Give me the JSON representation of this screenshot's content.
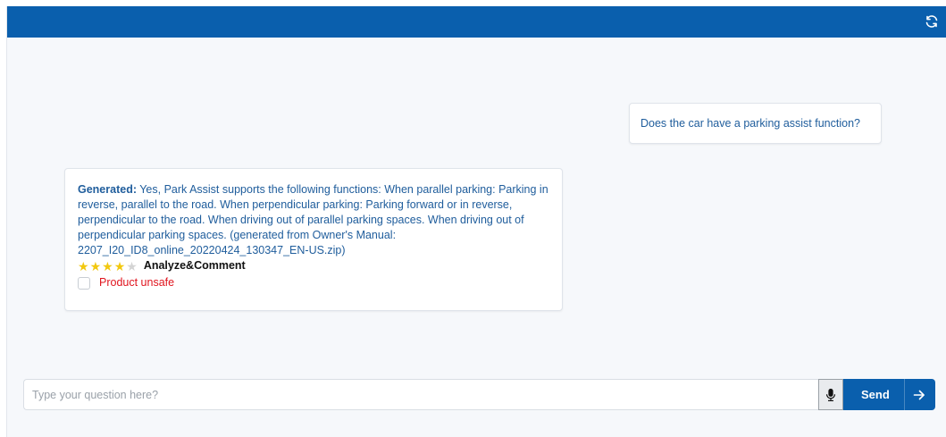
{
  "header": {
    "refresh_icon": "refresh-icon"
  },
  "chat": {
    "user_message": "Does the car have a parking assist function?",
    "bot_message": {
      "label": "Generated:",
      "text": " Yes, Park Assist supports the following functions: When parallel parking: Parking in reverse, parallel to the road. When perpendicular parking: Parking forward or in reverse, perpendicular to the road. When driving out of parallel parking spaces. When driving out of perpendicular parking spaces. (generated from Owner's Manual: 2207_I20_ID8_online_20220424_130347_EN-US.zip)",
      "rating": 4,
      "rating_max": 5,
      "analyze_label": "Analyze&Comment",
      "unsafe_label": "Product unsafe"
    }
  },
  "input": {
    "placeholder": "Type your question here?",
    "value": "",
    "mic_icon": "microphone-icon",
    "send_label": "Send",
    "send_icon": "arrow-right-icon"
  },
  "colors": {
    "brand": "#0a5fad",
    "message_text": "#1f5d9c",
    "star_on": "#f2c80f",
    "star_off": "#d4d4d4",
    "unsafe": "#e0141e"
  }
}
